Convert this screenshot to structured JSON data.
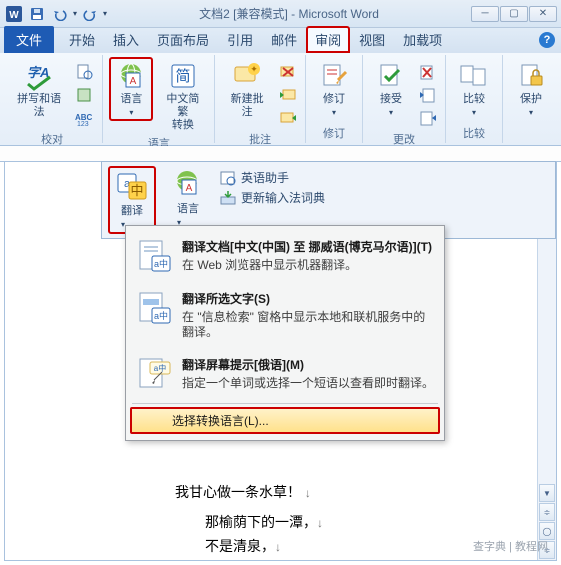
{
  "title": "文档2 [兼容模式] - Microsoft Word",
  "qat": {
    "save": "保存",
    "undo": "撤销",
    "redo": "重做"
  },
  "tabs": {
    "file": "文件",
    "home": "开始",
    "insert": "插入",
    "layout": "页面布局",
    "ref": "引用",
    "mail": "邮件",
    "review": "审阅",
    "view": "视图",
    "addin": "加载项"
  },
  "ribbon": {
    "proofing_label": "校对",
    "spell": "拼写和语法",
    "language": "语言",
    "cnconv": "中文简繁\n转换",
    "newcomment": "新建批注",
    "comments_label": "批注",
    "track": "修订",
    "accept": "接受",
    "changes_label": "更改",
    "compare": "比较",
    "compare_label": "比较",
    "protect": "保护"
  },
  "langbar": {
    "translate": "翻译",
    "language": "语言",
    "enghelper": "英语助手",
    "updateime": "更新输入法词典"
  },
  "menu": {
    "i1_title": "翻译文档[中文(中国) 至 挪威语(博克马尔语)](T)",
    "i1_desc": "在 Web 浏览器中显示机器翻译。",
    "i2_title": "翻译所选文字(S)",
    "i2_desc": "在 \"信息检索\" 窗格中显示本地和联机服务中的翻译。",
    "i3_title": "翻译屏幕提示[俄语](M)",
    "i3_desc": "指定一个单词或选择一个短语以查看即时翻译。",
    "i4": "选择转换语言(L)..."
  },
  "doc": {
    "l1": "我甘心做一条水草！",
    "l2": "那榆荫下的一潭，",
    "l3": "不是清泉，"
  },
  "watermark": "查字典 | 教程网"
}
